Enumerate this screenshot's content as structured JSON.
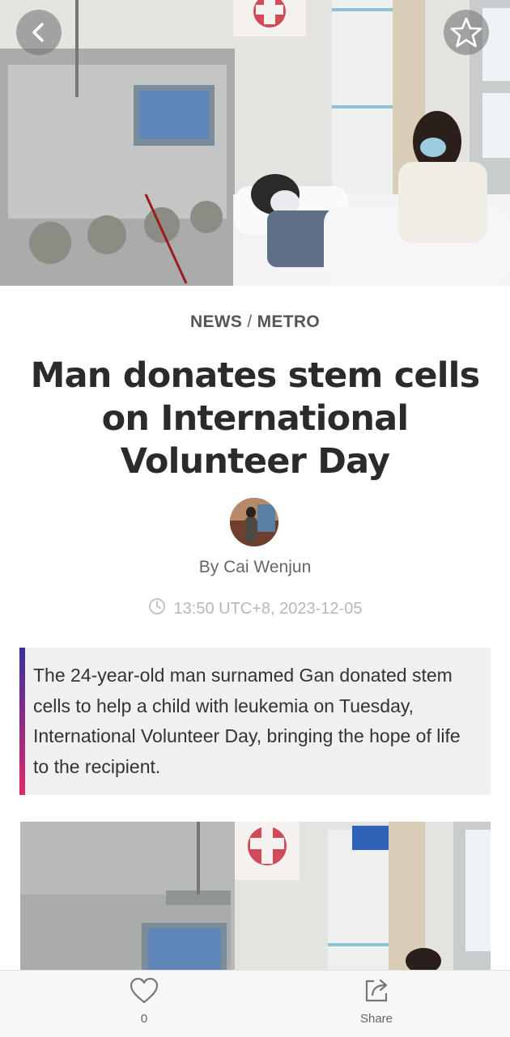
{
  "header": {
    "back_icon": "chevron-left-icon",
    "favorite_icon": "star-outline-icon"
  },
  "article": {
    "category": "NEWS",
    "separator": "/",
    "subcategory": "METRO",
    "title": "Man donates stem cells on International Volunteer Day",
    "byline": "By Cai Wenjun",
    "timestamp": "13:50 UTC+8, 2023-12-05",
    "summary": "The 24-year-old man surnamed Gan donated stem cells to help a child with leukemia on Tuesday, International Volunteer Day, bringing the hope of life to the recipient."
  },
  "bottom_bar": {
    "like_count": "0",
    "share_label": "Share"
  },
  "colors": {
    "accent_top": "#3b2fa0",
    "accent_bottom": "#e0286a",
    "summary_bg": "#f0f0f0"
  }
}
